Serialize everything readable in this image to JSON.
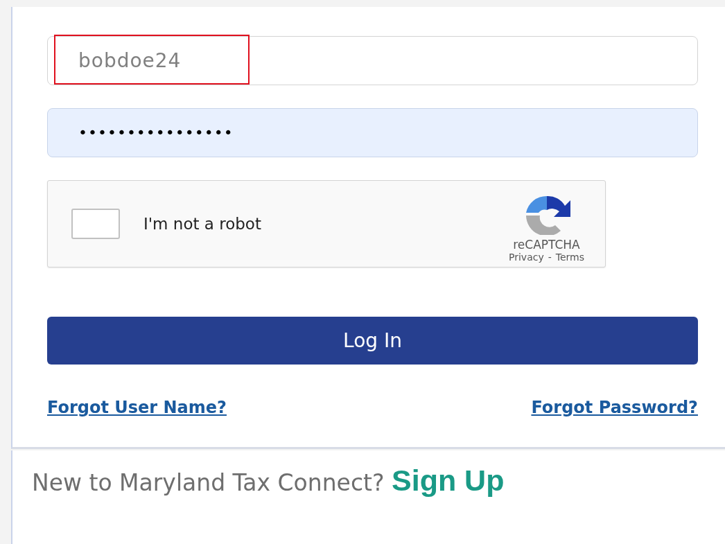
{
  "username_field": {
    "value": "bobdoe24",
    "highlighted": true
  },
  "password_field": {
    "value": "••••••••••••••••",
    "autofilled": true
  },
  "captcha": {
    "checked": false,
    "label": "I'm not a robot",
    "brand": "reCAPTCHA",
    "privacy_link": "Privacy",
    "separator": "-",
    "terms_link": "Terms"
  },
  "login_button": "Log In",
  "links": [
    "Forgot User Name?",
    "Forgot Password?"
  ],
  "signup": {
    "prompt": "New to Maryland Tax Connect?",
    "link": "Sign Up"
  }
}
